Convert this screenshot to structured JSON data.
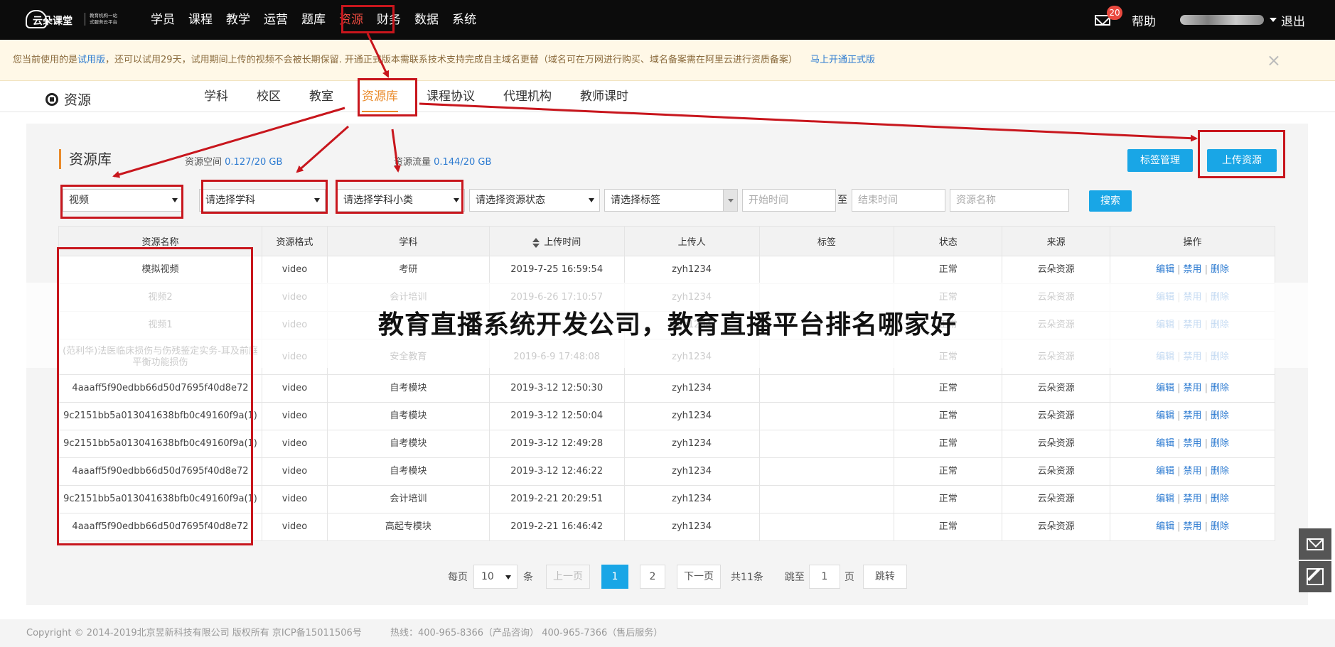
{
  "top_nav": {
    "logo": {
      "name": "云朵课堂",
      "tagline_line1": "教育机构一站",
      "tagline_line2": "式服务云平台"
    },
    "items": [
      "学员",
      "课程",
      "教学",
      "运营",
      "题库",
      "资源",
      "财务",
      "数据",
      "系统"
    ],
    "active_item": "资源",
    "mail_badge": "20",
    "help": "帮助",
    "logout": "退出"
  },
  "notice": {
    "text_before": "您当前使用的是",
    "trial_link": "试用版",
    "text_after": "，还可以试用29天，试用期间上传的视频不会被长期保留. 开通正式版本需联系技术支持完成自主域名更替（域名可在万网进行购买、域名备案需在阿里云进行资质备案）",
    "upgrade_link": "马上开通正式版",
    "close": "×"
  },
  "sub_nav": {
    "title": "资源",
    "tabs": [
      "学科",
      "校区",
      "教室",
      "资源库",
      "课程协议",
      "代理机构",
      "教师课时"
    ],
    "active_tab": "资源库"
  },
  "resource_panel": {
    "title": "资源库",
    "space_label": "资源空间",
    "space_value": "0.127/20 GB",
    "traffic_label": "资源流量",
    "traffic_value": "0.144/20 GB",
    "tag_manage_button": "标签管理",
    "upload_button": "上传资源"
  },
  "filters": {
    "type_value": "视频",
    "subject": "请选择学科",
    "subject_sub": "请选择学科小类",
    "status": "请选择资源状态",
    "tag": "请选择标签",
    "start_time_placeholder": "开始时间",
    "to": "至",
    "end_time_placeholder": "结束时间",
    "name_placeholder": "资源名称",
    "search_button": "搜索"
  },
  "table": {
    "headers": [
      "资源名称",
      "资源格式",
      "学科",
      "上传时间",
      "上传人",
      "标签",
      "状态",
      "来源",
      "操作"
    ],
    "actions": [
      "编辑",
      "禁用",
      "删除"
    ],
    "rows": [
      {
        "name": "模拟视频",
        "format": "video",
        "subject": "考研",
        "time": "2019-7-25 16:59:54",
        "uploader": "zyh1234",
        "tag": "",
        "status": "正常",
        "source": "云朵资源"
      },
      {
        "name": "视频2",
        "format": "video",
        "subject": "会计培训",
        "time": "2019-6-26 17:10:57",
        "uploader": "zyh1234",
        "tag": "",
        "status": "正常",
        "source": "云朵资源"
      },
      {
        "name": "视频1",
        "format": "video",
        "subject": "",
        "time": "",
        "uploader": "zyh1234",
        "tag": "",
        "status": "正常",
        "source": "云朵资源"
      },
      {
        "name": "(范利华)法医临床损伤与伤残鉴定实务-耳及前庭平衡功能损伤",
        "format": "video",
        "subject": "安全教育",
        "time": "2019-6-9 17:48:08",
        "uploader": "zyh1234",
        "tag": "",
        "status": "正常",
        "source": "云朵资源"
      },
      {
        "name": "4aaaff5f90edbb66d50d7695f40d8e72",
        "format": "video",
        "subject": "自考模块",
        "time": "2019-3-12 12:50:30",
        "uploader": "zyh1234",
        "tag": "",
        "status": "正常",
        "source": "云朵资源"
      },
      {
        "name": "9c2151bb5a013041638bfb0c49160f9a(1)",
        "format": "video",
        "subject": "自考模块",
        "time": "2019-3-12 12:50:04",
        "uploader": "zyh1234",
        "tag": "",
        "status": "正常",
        "source": "云朵资源"
      },
      {
        "name": "9c2151bb5a013041638bfb0c49160f9a(1)",
        "format": "video",
        "subject": "自考模块",
        "time": "2019-3-12 12:49:28",
        "uploader": "zyh1234",
        "tag": "",
        "status": "正常",
        "source": "云朵资源"
      },
      {
        "name": "4aaaff5f90edbb66d50d7695f40d8e72",
        "format": "video",
        "subject": "自考模块",
        "time": "2019-3-12 12:46:22",
        "uploader": "zyh1234",
        "tag": "",
        "status": "正常",
        "source": "云朵资源"
      },
      {
        "name": "9c2151bb5a013041638bfb0c49160f9a(1)",
        "format": "video",
        "subject": "会计培训",
        "time": "2019-2-21 20:29:51",
        "uploader": "zyh1234",
        "tag": "",
        "status": "正常",
        "source": "云朵资源"
      },
      {
        "name": "4aaaff5f90edbb66d50d7695f40d8e72",
        "format": "video",
        "subject": "高起专模块",
        "time": "2019-2-21 16:46:42",
        "uploader": "zyh1234",
        "tag": "",
        "status": "正常",
        "source": "云朵资源"
      }
    ]
  },
  "overlay_title": "教育直播系统开发公司，教育直播平台排名哪家好",
  "pagination": {
    "per_page_label": "每页",
    "per_page_value": "10",
    "per_page_unit": "条",
    "prev": "上一页",
    "pages": [
      "1",
      "2"
    ],
    "current": "1",
    "next": "下一页",
    "total": "共11条",
    "jump_label": "跳至",
    "jump_value": "1",
    "page_unit": "页",
    "jump_button": "跳转"
  },
  "footer": {
    "copyright": "Copyright © 2014-2019北京昱新科技有限公司 版权所有 京ICP备15011506号",
    "hotline": "热线：400-965-8366（产品咨询） 400-965-7366（售后服务）"
  },
  "side_buttons": [
    "mail-icon",
    "edit-icon"
  ],
  "colors": {
    "accent": "#19a6e6",
    "annotation_red": "#c8161d",
    "active_tab": "#e98a2a",
    "link": "#2d7bd1"
  }
}
